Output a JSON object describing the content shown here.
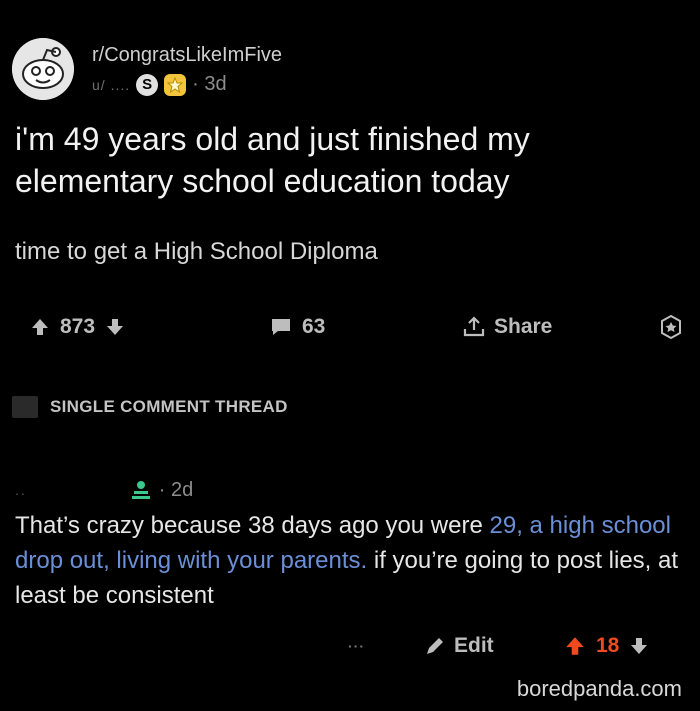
{
  "post": {
    "subreddit": "r/CongratsLikeImFive",
    "username": "u/ ....",
    "age": "· 3d",
    "title": "i'm 49 years old and just finished my elementary school education today",
    "body": "time to get a High School Diploma",
    "upvotes": "873",
    "comments": "63",
    "share_label": "Share"
  },
  "thread": {
    "label": "SINGLE COMMENT THREAD"
  },
  "comment": {
    "username": "..",
    "age": "· 2d",
    "text_before": "That’s crazy because 38 days ago you were ",
    "link_text": "29, a high school drop out, living with your parents.",
    "text_after": " if you’re going to post lies, at least be consistent",
    "dots": "···",
    "edit_label": "Edit",
    "score": "18"
  },
  "watermark": "boredpanda.com",
  "colors": {
    "background": "#000000",
    "link": "#6b8fd6",
    "upvote_active": "#f04a1f",
    "award": "#f2c53d"
  }
}
